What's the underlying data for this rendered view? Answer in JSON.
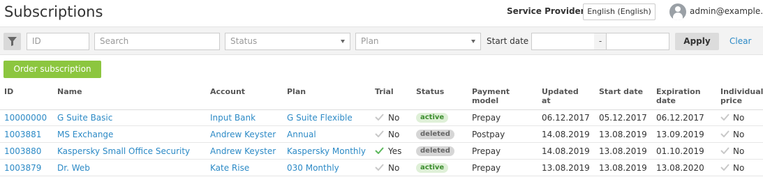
{
  "header": {
    "title": "Subscriptions",
    "provider": "Service Provider",
    "language": "English (English)",
    "user": "admin@example.com"
  },
  "filters": {
    "id_placeholder": "ID",
    "search_placeholder": "Search",
    "status_placeholder": "Status",
    "plan_placeholder": "Plan",
    "start_date_label": "Start date",
    "date_separator": "-",
    "apply_label": "Apply",
    "clear_label": "Clear"
  },
  "order_label": "Order subscription",
  "columns": {
    "id": "ID",
    "name": "Name",
    "account": "Account",
    "plan": "Plan",
    "trial": "Trial",
    "status": "Status",
    "payment_1": "Payment",
    "payment_2": "model",
    "updated_1": "Updated",
    "updated_2": "at",
    "start": "Start date",
    "expiration_1": "Expiration",
    "expiration_2": "date",
    "individual_1": "Individual",
    "individual_2": "price"
  },
  "rows": [
    {
      "id": "10000000",
      "name": "G Suite Basic",
      "account": "Input Bank",
      "plan": "G Suite Flexible",
      "trial": "No",
      "trial_on": false,
      "status": "active",
      "payment": "Prepay",
      "updated": "06.12.2017",
      "start": "05.12.2017",
      "expiration": "06.12.2017",
      "individual": "No"
    },
    {
      "id": "1003881",
      "name": "MS Exchange",
      "account": "Andrew Keyster",
      "plan": "Annual",
      "trial": "No",
      "trial_on": false,
      "status": "deleted",
      "payment": "Postpay",
      "updated": "14.08.2019",
      "start": "13.08.2019",
      "expiration": "13.09.2019",
      "individual": "No"
    },
    {
      "id": "1003880",
      "name": "Kaspersky Small Office Security",
      "account": "Andrew Keyster",
      "plan": "Kaspersky Monthly",
      "trial": "Yes",
      "trial_on": true,
      "status": "deleted",
      "payment": "Prepay",
      "updated": "14.08.2019",
      "start": "13.08.2019",
      "expiration": "01.10.2019",
      "individual": "No"
    },
    {
      "id": "1003879",
      "name": "Dr. Web",
      "account": "Kate Rise",
      "plan": "030 Monthly",
      "trial": "No",
      "trial_on": false,
      "status": "active",
      "payment": "Prepay",
      "updated": "13.08.2019",
      "start": "13.08.2019",
      "expiration": "13.08.2020",
      "individual": "No"
    }
  ],
  "colors": {
    "link": "#2c8ac6",
    "check_on": "#5cb85c",
    "check_off": "#c8c8c8",
    "order_button": "#8cc63f"
  }
}
